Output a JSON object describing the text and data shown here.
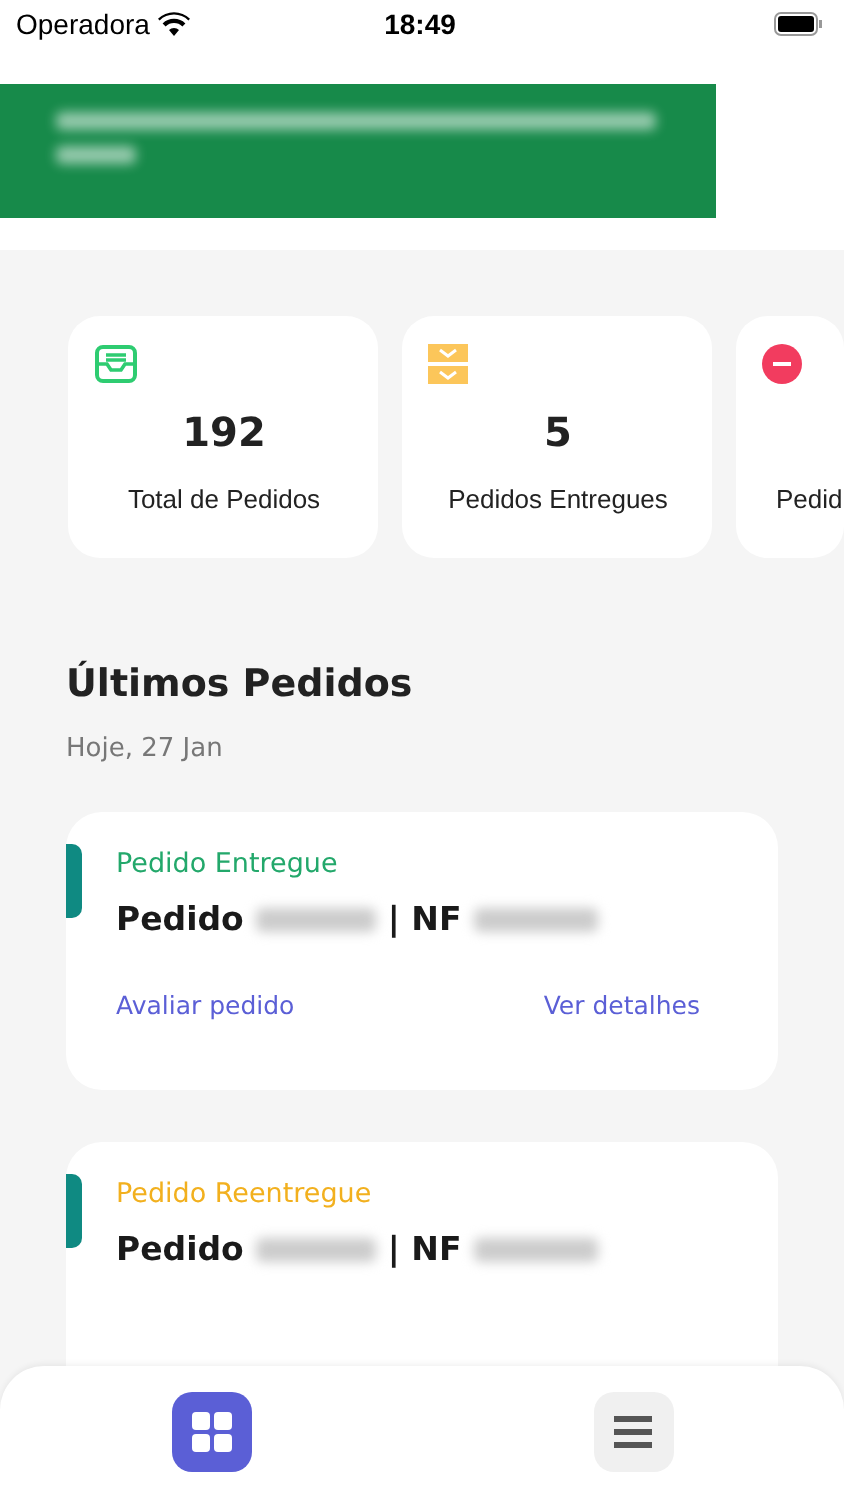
{
  "status_bar": {
    "carrier": "Operadora",
    "time": "18:49"
  },
  "stats": [
    {
      "kind": "inbox",
      "color": "#2ecc71",
      "value": "192",
      "label": "Total de Pedidos"
    },
    {
      "kind": "tray",
      "color": "#fcc65a",
      "value": "5",
      "label": "Pedidos Entregues"
    },
    {
      "kind": "minus",
      "color": "#f23c5f",
      "label": "Pedid"
    }
  ],
  "section": {
    "title": "Últimos Pedidos",
    "date": "Hoje, 27 Jan"
  },
  "orders": [
    {
      "status": "Pedido Entregue",
      "color": "#23a86b",
      "order_label": "Pedido",
      "nf_label": "| NF",
      "links": [
        "Avaliar pedido",
        "Ver detalhes"
      ]
    },
    {
      "status": "Pedido Reentregue",
      "color": "#f2b01e",
      "order_label": "Pedido",
      "nf_label": "| NF"
    }
  ],
  "tab_bar": [
    {
      "kind": "grid",
      "selected": true
    },
    {
      "kind": "menu",
      "selected": false
    }
  ]
}
